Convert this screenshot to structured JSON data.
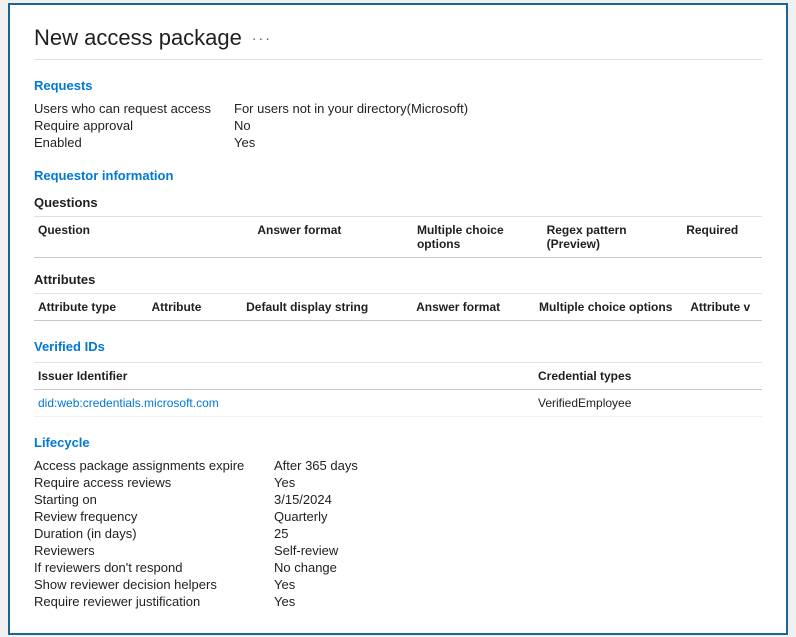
{
  "page": {
    "title": "New access package",
    "ellipsis": "···"
  },
  "requests": {
    "section_title": "Requests",
    "fields": [
      {
        "label": "Users who can request access",
        "value": "For users not in your directory(Microsoft)"
      },
      {
        "label": "Require approval",
        "value": "No"
      },
      {
        "label": "Enabled",
        "value": "Yes"
      }
    ]
  },
  "requestor_information": {
    "section_title": "Requestor information",
    "questions": {
      "sub_title": "Questions",
      "headers": [
        "Question",
        "Answer format",
        "Multiple choice options",
        "Regex pattern (Preview)",
        "Required"
      ],
      "rows": []
    },
    "attributes": {
      "sub_title": "Attributes",
      "headers": [
        "Attribute type",
        "Attribute",
        "Default display string",
        "Answer format",
        "Multiple choice options",
        "Attribute v"
      ],
      "rows": []
    }
  },
  "verified_ids": {
    "section_title": "Verified IDs",
    "headers": [
      "Issuer Identifier",
      "Credential types"
    ],
    "rows": [
      {
        "issuer": "did:web:credentials.microsoft.com",
        "credential": "VerifiedEmployee"
      }
    ]
  },
  "lifecycle": {
    "section_title": "Lifecycle",
    "fields": [
      {
        "label": "Access package assignments expire",
        "value": "After 365 days"
      },
      {
        "label": "Require access reviews",
        "value": "Yes"
      },
      {
        "label": "Starting on",
        "value": "3/15/2024"
      },
      {
        "label": "Review frequency",
        "value": "Quarterly"
      },
      {
        "label": "Duration (in days)",
        "value": "25"
      },
      {
        "label": "Reviewers",
        "value": "Self-review"
      },
      {
        "label": "If reviewers don't respond",
        "value": "No change"
      },
      {
        "label": "Show reviewer decision helpers",
        "value": "Yes"
      },
      {
        "label": "Require reviewer justification",
        "value": "Yes"
      }
    ]
  }
}
